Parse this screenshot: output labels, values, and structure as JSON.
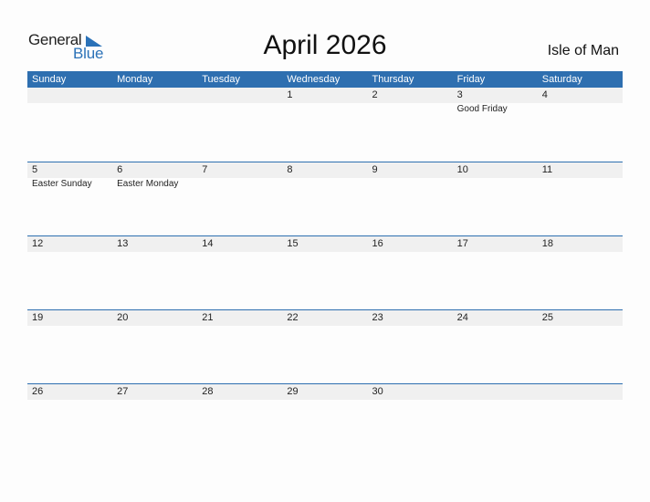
{
  "logo": {
    "general": "General",
    "blue": "Blue"
  },
  "header": {
    "title": "April 2026",
    "region": "Isle of Man"
  },
  "colors": {
    "accent": "#2e6fb0",
    "band": "#f0f0f0"
  },
  "weekdays": [
    "Sunday",
    "Monday",
    "Tuesday",
    "Wednesday",
    "Thursday",
    "Friday",
    "Saturday"
  ],
  "weeks": [
    {
      "days": [
        "",
        "",
        "",
        "1",
        "2",
        "3",
        "4"
      ],
      "holidays": [
        "",
        "",
        "",
        "",
        "",
        "Good Friday",
        ""
      ]
    },
    {
      "days": [
        "5",
        "6",
        "7",
        "8",
        "9",
        "10",
        "11"
      ],
      "holidays": [
        "Easter Sunday",
        "Easter Monday",
        "",
        "",
        "",
        "",
        ""
      ]
    },
    {
      "days": [
        "12",
        "13",
        "14",
        "15",
        "16",
        "17",
        "18"
      ],
      "holidays": [
        "",
        "",
        "",
        "",
        "",
        "",
        ""
      ]
    },
    {
      "days": [
        "19",
        "20",
        "21",
        "22",
        "23",
        "24",
        "25"
      ],
      "holidays": [
        "",
        "",
        "",
        "",
        "",
        "",
        ""
      ]
    },
    {
      "days": [
        "26",
        "27",
        "28",
        "29",
        "30",
        "",
        ""
      ],
      "holidays": [
        "",
        "",
        "",
        "",
        "",
        "",
        ""
      ]
    }
  ]
}
